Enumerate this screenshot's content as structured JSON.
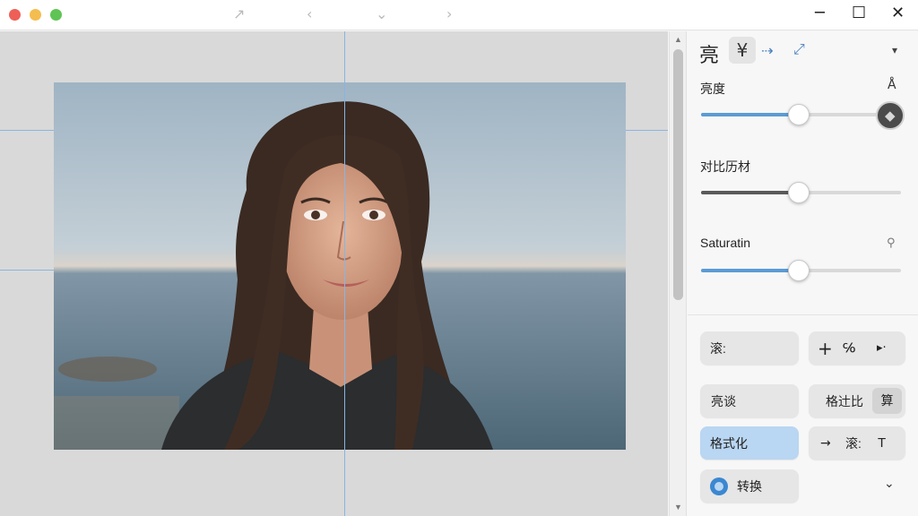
{
  "titlebar": {
    "nav_icons": [
      "↗",
      "‹",
      "⌄",
      "›"
    ],
    "window_controls": [
      "─",
      "☐",
      "✕"
    ]
  },
  "panel": {
    "toolbar": {
      "title": "亮",
      "tools": [
        "¥",
        "⇢",
        "⤢"
      ],
      "menu_caret": "▾"
    },
    "sliders": [
      {
        "label": "亮度",
        "value": 0.49,
        "fill_color": "#5b9bd5"
      },
      {
        "label": "对比历材",
        "value": 0.49,
        "fill_color": "#5a5a5a"
      },
      {
        "label": "Saturatin",
        "value": 0.49,
        "fill_color": "#5b9bd5"
      }
    ],
    "slider_icons": {
      "brightness_side": "Å",
      "saturation_side": "⚲"
    },
    "buttons": {
      "r1_left": "滚:",
      "r1_right": [
        "+",
        "℅",
        "▸·"
      ],
      "r2_left": "亮谈",
      "r2_right": "格辻比",
      "r2_right_badge": "算",
      "r3_left": "格式化",
      "r3_right": [
        "→",
        "滚:",
        "T"
      ],
      "r4_left": "转换",
      "r4_caret": "⌄"
    }
  }
}
